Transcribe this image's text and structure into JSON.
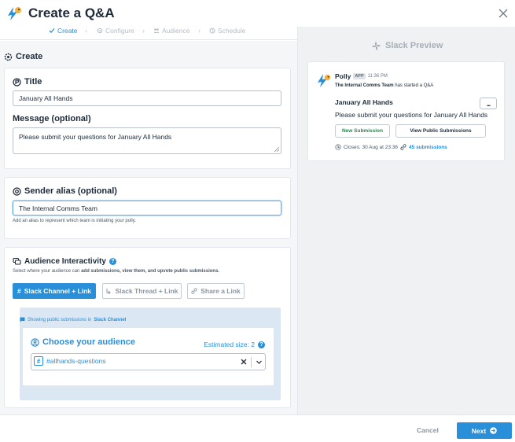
{
  "header": {
    "title": "Create a Q&A"
  },
  "stepper": {
    "steps": [
      {
        "label": "Create",
        "icon": "check-icon"
      },
      {
        "label": "Configure",
        "icon": "gear-icon"
      },
      {
        "label": "Audience",
        "icon": "people-icon"
      },
      {
        "label": "Schedule",
        "icon": "clock-icon"
      }
    ],
    "active": 0
  },
  "left": {
    "section_title": "Create",
    "title_field": {
      "label": "Title",
      "value": "January All Hands"
    },
    "message_field": {
      "label": "Message (optional)",
      "value": "Please submit your questions for January All Hands"
    },
    "sender": {
      "label": "Sender alias (optional)",
      "value": "The Internal Comms Team",
      "help": "Add an alias to represent which team is initiating your polly."
    },
    "interactivity": {
      "label": "Audience Interactivity",
      "help_pre": "Select where your audience can ",
      "help_bold": "add submissions, view them, and upvote public submissions.",
      "options": [
        "Slack Channel + Link",
        "Slack Thread + Link",
        "Share a Link"
      ],
      "selected": 0,
      "showing_pre": "Showing public submissions in ",
      "showing_channel": "Slack Channel"
    },
    "audience": {
      "title": "Choose your audience",
      "estimated": "Estimated size: 2",
      "channel": "#allhands-questions"
    }
  },
  "preview": {
    "title": "Slack Preview",
    "app_name": "Polly",
    "app_badge": "APP",
    "time": "11:36 PM",
    "started_by": "The Internal Comms Team",
    "started_text": " has started a Q&A",
    "q_title": "January All Hands",
    "q_message": "Please submit your questions for January All Hands",
    "more": "...",
    "btn_new": "New Submission",
    "btn_view": "View Public Submissions",
    "closes": "Closes: 30 Aug at 23:36",
    "submissions": "45 submissions"
  },
  "footer": {
    "cancel": "Cancel",
    "next": "Next"
  },
  "colors": {
    "accent": "#2a8fd9",
    "text": "#1d2b3a",
    "green": "#1f8a4c"
  }
}
